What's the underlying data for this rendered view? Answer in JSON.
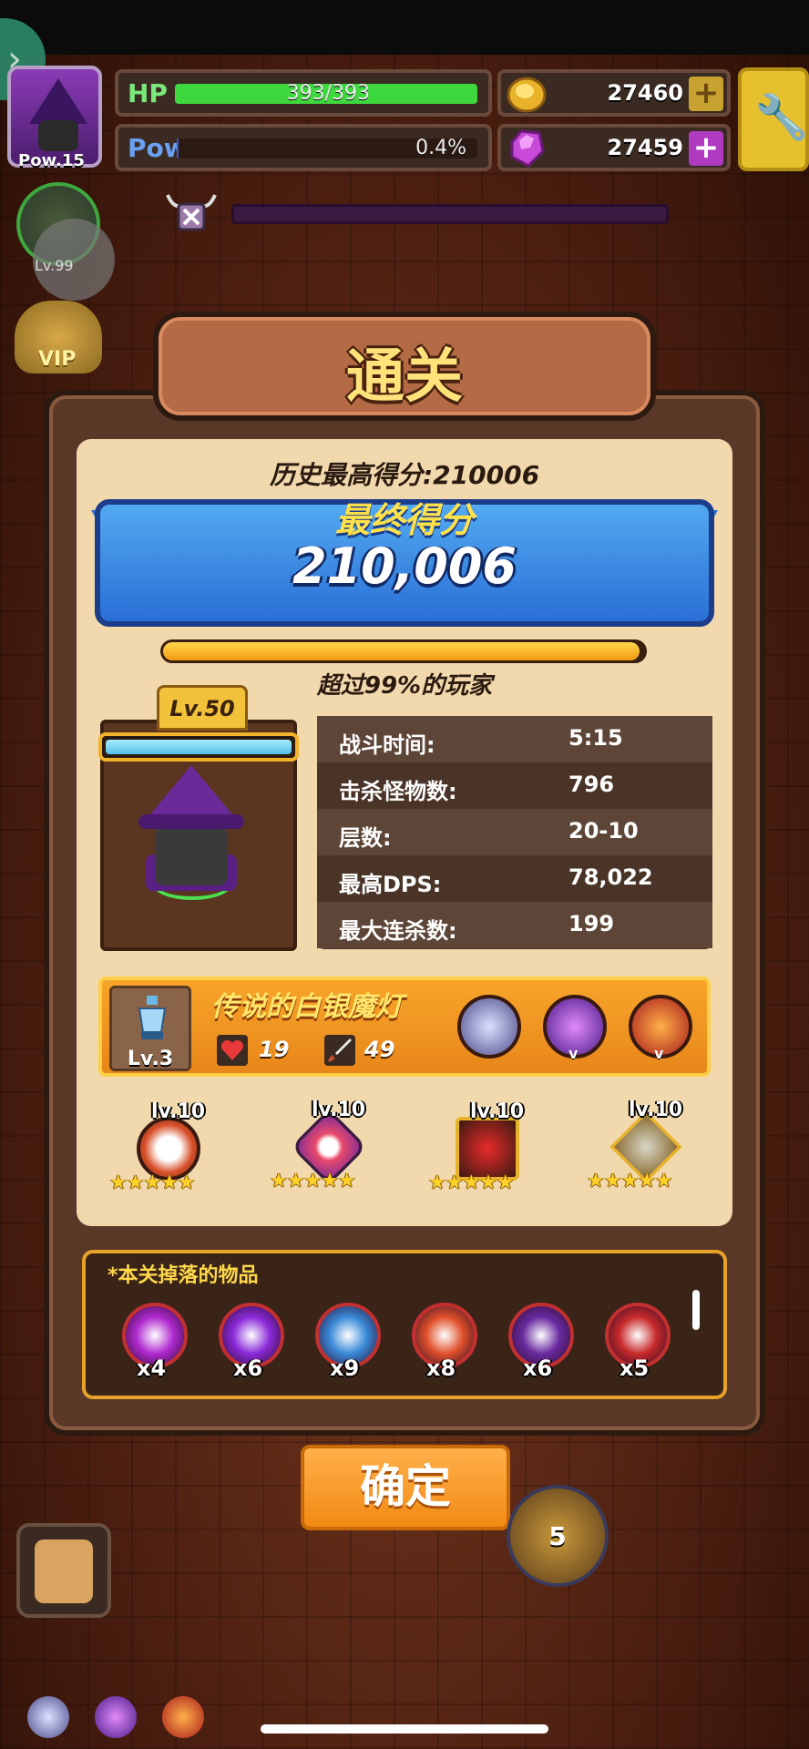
{
  "hud": {
    "pow_label": "Pow.15",
    "hp": {
      "label": "HP",
      "value": "393/393",
      "fill": 1.0
    },
    "pow": {
      "label": "Pow",
      "value": "0.4%",
      "fill": 0.004
    },
    "gold": "27460",
    "gems": "27459",
    "side_lv": "Lv.99",
    "vip": "VIP"
  },
  "dialog": {
    "title": "通关",
    "best_score": "历史最高得分:210006",
    "final_label": "最终得分",
    "final_score": "210,006",
    "percent_fill": 0.99,
    "percent_text": "超过99%的玩家",
    "hero_level": "Lv.50",
    "stats": [
      {
        "label": "战斗时间:",
        "value": "5:15"
      },
      {
        "label": "击杀怪物数:",
        "value": "796"
      },
      {
        "label": "层数:",
        "value": "20-10"
      },
      {
        "label": "最高DPS:",
        "value": "78,022"
      },
      {
        "label": "最大连杀数:",
        "value": "199"
      }
    ],
    "weapon": {
      "name": "传说的白银魔灯",
      "level": "Lv.3",
      "hp_stat": "19",
      "atk_stat": "49",
      "orb_tag": "v"
    },
    "equipment": [
      {
        "level": "lv.10",
        "stars": "★★★★★"
      },
      {
        "level": "lv.10",
        "stars": "★★★★★"
      },
      {
        "level": "lv.10",
        "stars": "★★★★★"
      },
      {
        "level": "lv.10",
        "stars": "★★★★★"
      }
    ],
    "drops_title": "*本关掉落的物品",
    "drops": [
      {
        "count": "x4",
        "color": "#b02ad0"
      },
      {
        "count": "x6",
        "color": "#8a2ad8"
      },
      {
        "count": "x9",
        "color": "#3a8ad8"
      },
      {
        "count": "x8",
        "color": "#e0502a"
      },
      {
        "count": "x6",
        "color": "#6a2aa0"
      },
      {
        "count": "x5",
        "color": "#c82a2a"
      }
    ],
    "confirm": "确定"
  },
  "bottom": {
    "skill_count": "5"
  },
  "colors": {
    "hp_fill": "#3ed83e",
    "pow_fill": "#3a58b8",
    "gold": "#e8b22a",
    "gem": "#c84ad8"
  }
}
